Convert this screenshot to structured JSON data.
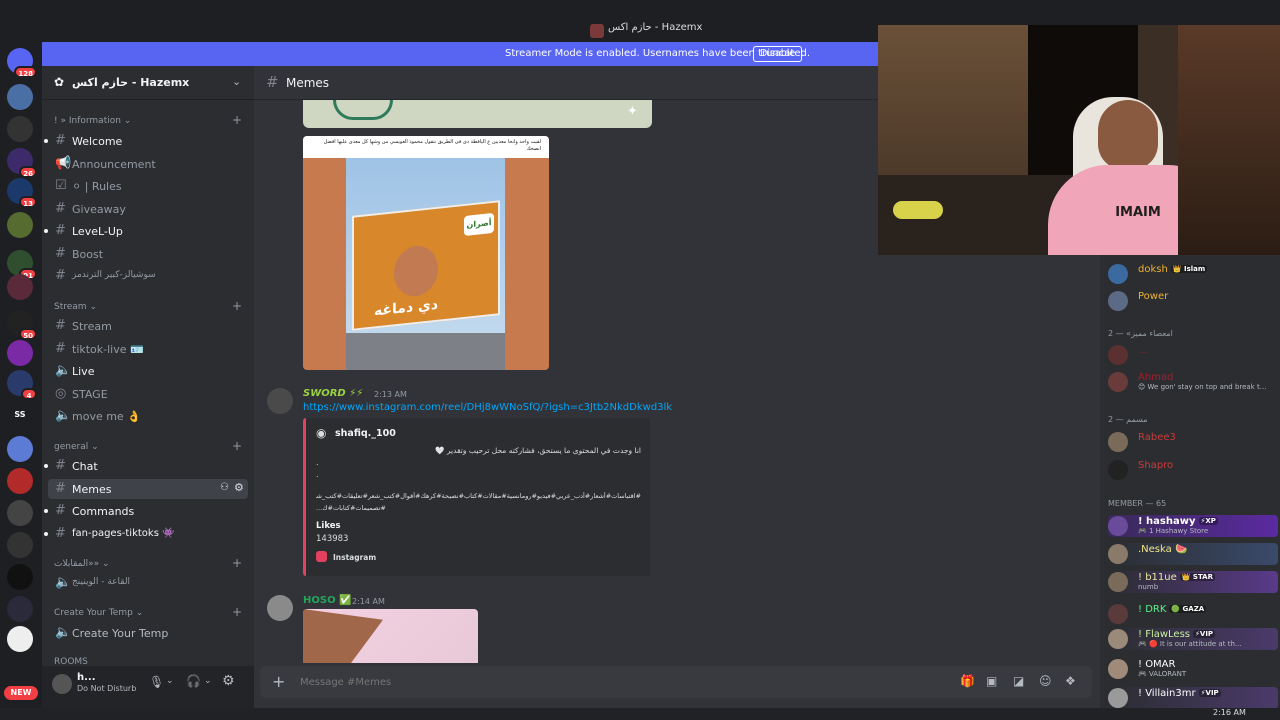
{
  "window": {
    "title": "حازم اكس - Hazemx"
  },
  "banner": {
    "text": "Streamer Mode is enabled. Usernames have been truncated.",
    "button": "Disable"
  },
  "servers": {
    "badges": [
      "128",
      "26",
      "13",
      "91",
      "50",
      "4"
    ],
    "ss_label": "SS",
    "new_label": "NEW"
  },
  "guild": {
    "name": "حازم اكس - Hazemx"
  },
  "categories": {
    "information": "» Information",
    "stream": "Stream",
    "general": "general",
    "ar_rooms": "المقابلات»»",
    "create_temp": "Create Your Temp",
    "rooms": "ROOMS"
  },
  "channels": {
    "welcome": "Welcome",
    "announcement": "Announcement",
    "rules": "⚪ | Rules",
    "giveaway": "Giveaway",
    "levelup": "LeveL-Up",
    "boost": "Boost",
    "social": "سوشيالز-كبير الترندمز",
    "stream": "Stream",
    "tiktok_live": "tiktok-live 🪪",
    "live": "Live",
    "stage": "STAGE",
    "move_me": "move me 👌",
    "chat": "Chat",
    "memes": "Memes",
    "commands": "Commands",
    "fan_pages": "fan-pages-tiktoks 👾",
    "ar_room": "القاعة - الوينينج",
    "create_temp": "Create Your Temp"
  },
  "user": {
    "name": "h...",
    "status": "Do Not Disturb"
  },
  "chat": {
    "channel_name": "Memes",
    "placeholder": "Message #Memes",
    "msg1_caption": "لقيت واحد وانحا معديين ع اليافطة دى فى الطريق نتقول محمود العويسي من وشها كل معدى عليها افضل انصحك",
    "billboard_ar": "دي دماغه",
    "billboard_brand": "أصران",
    "msg2": {
      "author": "SWORD ⚡⚡",
      "time": "2:13 AM",
      "link": "https://www.instagram.com/reel/DHj8wWNoSfQ/?igsh=c3Jtb2NkdDkwd3lk",
      "embed_author": "shafiq._100",
      "embed_line1": "انا وجدت في المحتوى ما يستحق، فشاركته محل ترحيب وتقدير 🤍",
      "embed_dots1": ".",
      "embed_dots2": ".",
      "embed_tags": "#اقتباسات#أشعار#أدب_عربي#فيديو#رومانسية#مقالات#كتاب#نصيحة#كرهك#أقوال#كتب_شعر#تعليقات#كتب_شعر",
      "embed_tags2": "#تصميمات#كتابات#ك...",
      "likes_label": "Likes",
      "likes_value": "143983",
      "source": "Instagram"
    },
    "msg3": {
      "author": "HOSO ✅",
      "time": "2:14 AM"
    }
  },
  "members": {
    "cat_a_label": "امعصاء مميز» — 2",
    "cat_b_label": "مسمم — 2",
    "cat_member": "MEMBER — 65",
    "items": [
      {
        "name": "doksh",
        "tag": "👑 Islam",
        "status": ""
      },
      {
        "name": "Power",
        "tag": "",
        "status": ""
      },
      {
        "name": "...",
        "tag": "",
        "status": ""
      },
      {
        "name": "Ahmad",
        "tag": "",
        "status": "😊 We gon' stay on top and break t..."
      },
      {
        "name": "Rabee3",
        "tag": "",
        "status": ""
      },
      {
        "name": "Shapro",
        "tag": "",
        "status": ""
      },
      {
        "name": "! hashawy",
        "tag": "⚡XP",
        "status": "🎮 1 Hashawy Store"
      },
      {
        "name": ".Neska 🍉",
        "tag": "",
        "status": ""
      },
      {
        "name": "! b11ue",
        "tag": "👑 STAR",
        "status": "numb"
      },
      {
        "name": "! DRK",
        "tag": "🟢 GAZA",
        "status": ""
      },
      {
        "name": "! FlawLess",
        "tag": "⚡VIP",
        "status": "🎮 🔴 It is our attitude at th..."
      },
      {
        "name": "! OMAR",
        "tag": "",
        "status": "🎮 VALORANT"
      },
      {
        "name": "! Villain3mr",
        "tag": "⚡VIP",
        "status": ""
      }
    ]
  },
  "clock": {
    "time": "2:16 AM"
  },
  "colors": {
    "accent": "#5865f2",
    "background": "#313338",
    "sidebar": "#2b2d31",
    "rail": "#1e1f22"
  }
}
